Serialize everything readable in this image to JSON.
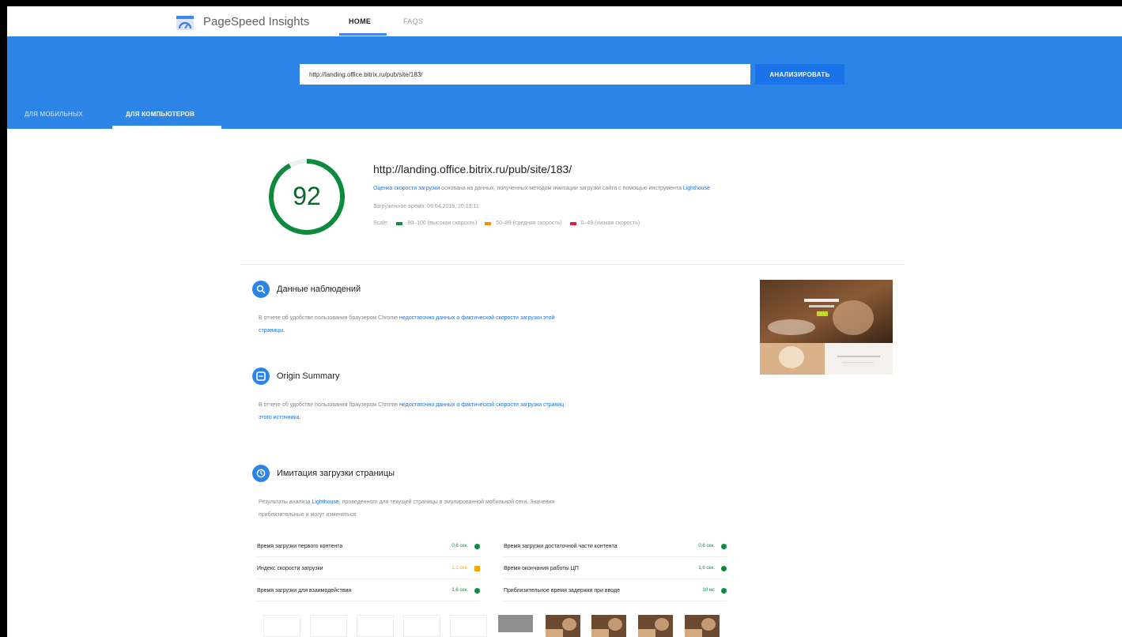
{
  "header": {
    "brand": "PageSpeed Insights",
    "nav": {
      "home": "HOME",
      "faq": "FAQS"
    }
  },
  "search": {
    "url_value": "http://landing.office.bitrix.ru/pub/site/183/",
    "analyze_label": "АНАЛИЗИРОВАТЬ"
  },
  "device_tabs": {
    "mobile": "ДЛЯ МОБИЛЬНЫХ",
    "desktop": "ДЛЯ КОМПЬЮТЕРОВ"
  },
  "score": {
    "value": 92,
    "value_text": "92",
    "url": "http://landing.office.bitrix.ru/pub/site/183/",
    "desc_link": "Оценка скорости загрузки",
    "desc_text": " основана на данных, полученных методом имитации загрузки сайта с помощью инструмента ",
    "desc_tool": "Lighthouse",
    "loaded_at": "Загруженное время: 09.04.2019, 20:13:11",
    "legend": {
      "label": "Scale:",
      "fast": "90–100 (высокая скорость)",
      "average": "50–89 (средняя скорость)",
      "slow": "0–49 (низкая скорость)"
    }
  },
  "sections": {
    "field": {
      "title": "Данные наблюдений",
      "text_a": "В отчете об удобстве пользования браузером Chrome ",
      "text_link": "недостаточно данных о фактической скорости загрузки этой",
      "text_b": "страницы."
    },
    "origin": {
      "title": "Origin Summary",
      "text_a": "В отчете об удобстве пользования браузером Chrome ",
      "text_link": "недостаточно данных о фактической скорости загрузки страниц",
      "text_b": "этого источника."
    },
    "lab": {
      "title": "Имитация загрузки страницы",
      "text_a": "Результаты анализа ",
      "text_link": "Lighthouse",
      "text_b": ", проведенного для текущей страницы в эмулированной мобильной сети. Значения",
      "text_c": "приблизительные и могут изменяться."
    }
  },
  "metrics": {
    "left": [
      {
        "name": "Время загрузки первого контента",
        "value": "0,6 сек."
      },
      {
        "name": "Индекс скорости загрузки",
        "value": "1,1 сек."
      },
      {
        "name": "Время загрузки для взаимодействия",
        "value": "1,6 сек."
      }
    ],
    "right": [
      {
        "name": "Время загрузки достаточной части контента",
        "value": "0,6 сек."
      },
      {
        "name": "Время окончания работы ЦП",
        "value": "1,6 сек."
      },
      {
        "name": "Приблизительное время задержки при вводе",
        "value": "10 мс"
      }
    ]
  },
  "colors": {
    "fast": "#0cce6b",
    "average": "#ffa400",
    "slow": "#ff4e42",
    "header": "#2c85e6"
  }
}
